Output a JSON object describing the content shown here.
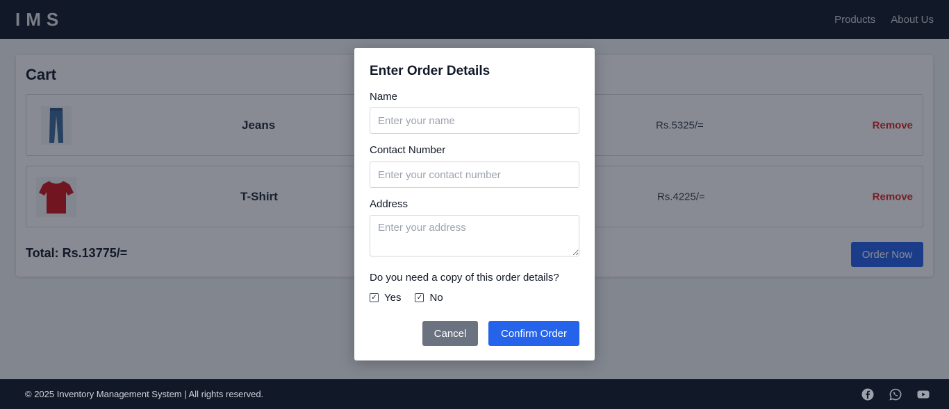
{
  "navbar": {
    "logo": "IMS",
    "links": [
      "Products",
      "About Us"
    ]
  },
  "cart": {
    "title": "Cart",
    "items": [
      {
        "name": "Jeans",
        "price": "Rs.5325/=",
        "remove_label": "Remove",
        "image_icon": "jeans-image"
      },
      {
        "name": "T-Shirt",
        "price": "Rs.4225/=",
        "remove_label": "Remove",
        "image_icon": "tshirt-image"
      }
    ],
    "total": "Total: Rs.13775/=",
    "order_now_label": "Order Now"
  },
  "modal": {
    "title": "Enter Order Details",
    "name_label": "Name",
    "name_placeholder": "Enter your name",
    "contact_label": "Contact Number",
    "contact_placeholder": "Enter your contact number",
    "address_label": "Address",
    "address_placeholder": "Enter your address",
    "copy_question": "Do you need a copy of this order details?",
    "options": [
      {
        "label": "Yes",
        "checked": true
      },
      {
        "label": "No",
        "checked": true
      }
    ],
    "cancel_label": "Cancel",
    "confirm_label": "Confirm Order"
  },
  "footer": {
    "copyright": "© 2025 Inventory Management System | All rights reserved.",
    "social_icons": [
      "facebook-icon",
      "whatsapp-icon",
      "youtube-icon"
    ]
  },
  "colors": {
    "navbar_bg": "#111827",
    "primary": "#2563eb",
    "danger": "#dc2626",
    "cancel": "#6b7280"
  }
}
